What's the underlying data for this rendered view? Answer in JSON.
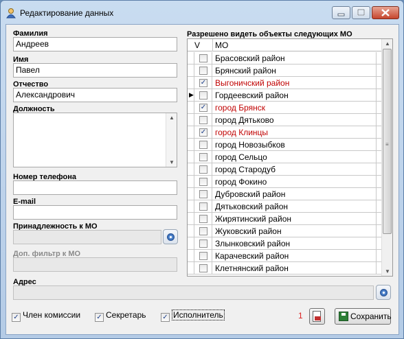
{
  "window": {
    "title": "Редактирование данных"
  },
  "form": {
    "surname": {
      "label": "Фамилия",
      "value": "Андреев"
    },
    "name": {
      "label": "Имя",
      "value": "Павел"
    },
    "patronymic": {
      "label": "Отчество",
      "value": "Александрович"
    },
    "position": {
      "label": "Должность",
      "value": ""
    },
    "phone": {
      "label": "Номер телефона",
      "value": ""
    },
    "email": {
      "label": "E-mail",
      "value": ""
    },
    "mo_membership": {
      "label": "Принадлежность к МО",
      "value": ""
    },
    "mo_filter": {
      "label": "Доп. фильтр к МО",
      "value": ""
    },
    "address": {
      "label": "Адрес",
      "value": ""
    }
  },
  "mo_grid": {
    "title": "Разрешено видеть объекты следующих МО",
    "columns": [
      "V",
      "МО"
    ],
    "rows": [
      {
        "name": "Брасовский район",
        "checked": false
      },
      {
        "name": "Брянский район",
        "checked": false
      },
      {
        "name": "Выгоничский район",
        "checked": true
      },
      {
        "name": "Гордеевский район",
        "checked": false
      },
      {
        "name": "город Брянск",
        "checked": true
      },
      {
        "name": "город Дятьково",
        "checked": false
      },
      {
        "name": "город Клинцы",
        "checked": true
      },
      {
        "name": "город Новозыбков",
        "checked": false
      },
      {
        "name": "город Сельцо",
        "checked": false
      },
      {
        "name": "город Стародуб",
        "checked": false
      },
      {
        "name": "город Фокино",
        "checked": false
      },
      {
        "name": "Дубровский район",
        "checked": false
      },
      {
        "name": "Дятьковский район",
        "checked": false
      },
      {
        "name": "Жирятинский район",
        "checked": false
      },
      {
        "name": "Жуковский район",
        "checked": false
      },
      {
        "name": "Злынковский район",
        "checked": false
      },
      {
        "name": "Карачевский район",
        "checked": false
      },
      {
        "name": "Клетнянский район",
        "checked": false
      }
    ],
    "current_row_index": 3
  },
  "checkboxes": {
    "commission_member": {
      "label": "Член комиссии",
      "checked": true
    },
    "secretary": {
      "label": "Секретарь",
      "checked": true
    },
    "executor": {
      "label": "Исполнитель",
      "checked": true
    }
  },
  "counter": "1",
  "buttons": {
    "save_label": "Сохранить"
  },
  "icons": {
    "app": "user-icon",
    "pick": "pick-icon",
    "print": "print-icon",
    "save": "save-icon",
    "check_mark": "✓",
    "row_pointer": "▶"
  },
  "colors": {
    "checked_row_text": "#c00000",
    "counter_text": "#dd2222"
  }
}
